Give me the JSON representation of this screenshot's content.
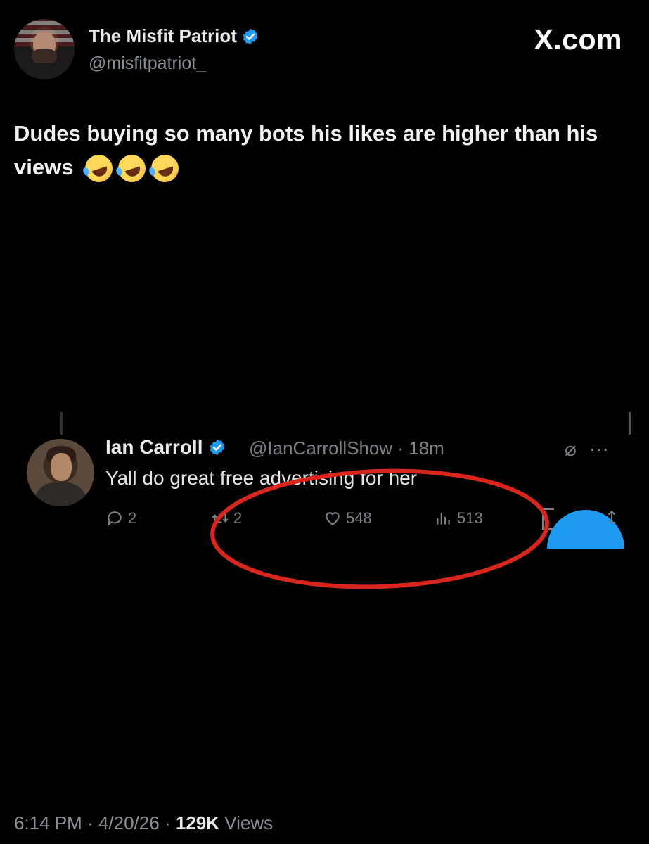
{
  "author": {
    "display_name": "The Misfit Patriot",
    "handle": "@misfitpatriot_",
    "verified": true
  },
  "brand": "X.com",
  "tweet": {
    "text": "Dudes buying so many bots his likes are higher than his views",
    "emojis": [
      "rolling-on-floor-laughing",
      "rolling-on-floor-laughing",
      "rolling-on-floor-laughing"
    ]
  },
  "embedded_post": {
    "display_name": "Ian Carroll",
    "handle_time": "@IanCarrollShow · 18m",
    "verified": true,
    "text": "Yall do great free advertising for her",
    "replies": "2",
    "reposts": "2",
    "likes": "548",
    "views": "513"
  },
  "footer": {
    "time": "6:14 PM",
    "sep1": "·",
    "date": "4/20/26",
    "sep2": "·",
    "views_count": "129K",
    "views_label": "Views"
  },
  "colors": {
    "background": "#000000",
    "verified_blue": "#1d9bf0",
    "annotation_red": "#d9261c"
  }
}
